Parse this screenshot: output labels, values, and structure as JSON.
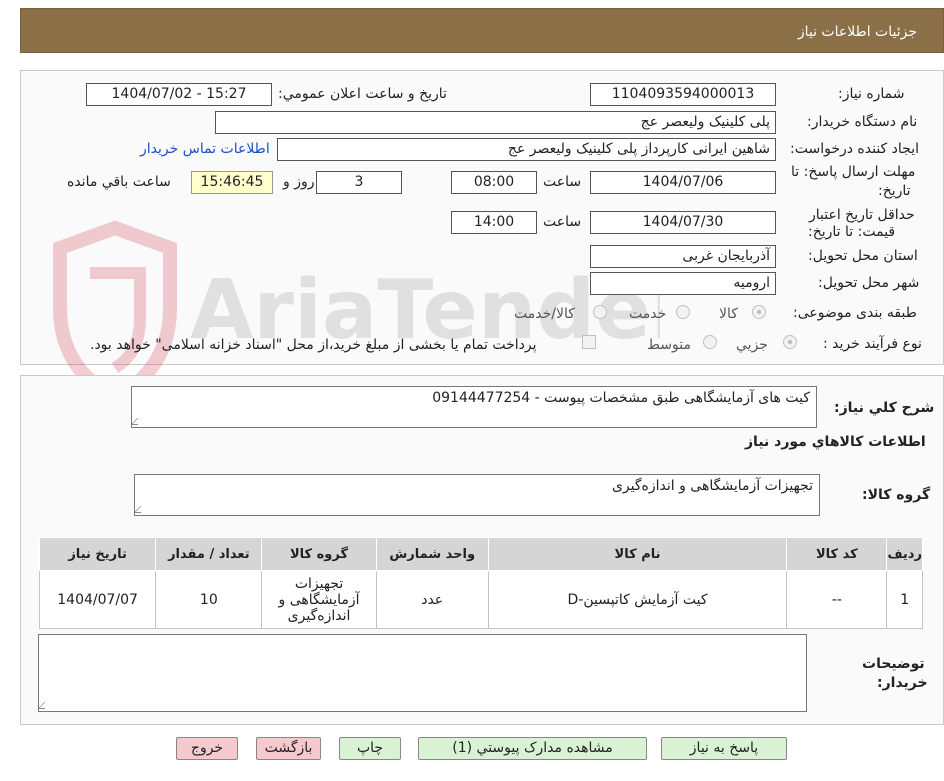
{
  "header": {
    "title": "جزئیات اطلاعات نیاز"
  },
  "watermark_text": "AriaTender.neT",
  "fields": {
    "need_number_label": "شماره نیاز:",
    "need_number": "1104093594000013",
    "announce_label": "تاریخ و ساعت اعلان عمومي:",
    "announce_value": "1404/07/02 - 15:27",
    "buyer_org_label": "نام دستگاه خریدار:",
    "buyer_org": "پلی کلینیک ولیعصر عج",
    "requester_label": "ایجاد کننده درخواست:",
    "requester": "شاهین ایرانی کارپرداز پلی کلینیک ولیعصر عج",
    "contact_link": "اطلاعات تماس خریدار",
    "deadline_label_1": "مهلت ارسال پاسخ: تا",
    "deadline_label_2": "تاریخ:",
    "deadline_date": "1404/07/06",
    "time_label": "ساعت",
    "deadline_time": "08:00",
    "days_value": "3",
    "days_label": "روز و",
    "remaining_time": "15:46:45",
    "remaining_label": "ساعت باقي مانده",
    "validity_label_1": "حداقل تاریخ اعتبار",
    "validity_label_2": "قیمت: تا تاریخ:",
    "validity_date": "1404/07/30",
    "validity_time": "14:00",
    "province_label": "استان محل تحویل:",
    "province": "آذربایجان غربی",
    "city_label": "شهر محل تحویل:",
    "city": "ارومیه",
    "category_label": "طبقه بندی موضوعی:",
    "category_options": [
      "کالا",
      "خدمت",
      "کالا/خدمت"
    ],
    "purchase_type_label": "نوع فرآیند خرید :",
    "purchase_options": [
      "جزیي",
      "متوسط"
    ],
    "payment_note": "پرداخت تمام یا بخشی از مبلغ خرید،از محل \"اسناد خزانه اسلامی\" خواهد بود."
  },
  "summary": {
    "description_label": "شرح کلي نياز:",
    "description": "کیت های آزمایشگاهی طبق مشخصات پیوست - 09144477254",
    "goods_info_title": "اطلاعات کالاهاي مورد نياز",
    "goods_group_label": "گروه کالا:",
    "goods_group": "تجهیزات آزمایشگاهی و اندازه‌گیری"
  },
  "table": {
    "headers": [
      "رديف",
      "کد کالا",
      "نام کالا",
      "واحد شمارش",
      "گروه کالا",
      "تعداد / مقدار",
      "تاریخ نیاز"
    ],
    "rows": [
      [
        "1",
        "--",
        "کیت آزمایش کاتپسین-D",
        "عدد",
        "تجهیزات آزمایشگاهی و اندازه‌گیری",
        "10",
        "1404/07/07"
      ]
    ]
  },
  "notes": {
    "label_1": "توضیحات",
    "label_2": "خریدار:",
    "value": ""
  },
  "buttons": {
    "reply": "پاسخ به نياز",
    "view_docs": "مشاهده مدارک پیوستي (1)",
    "print": "چاپ",
    "back": "بازگشت",
    "exit": "خروج"
  },
  "colors": {
    "header_bg": "#8b6f47",
    "link": "#1a4fc8",
    "green_btn": "#d9f2d4",
    "pink_btn": "#f6c9cf",
    "highlight": "#ffffcc"
  }
}
